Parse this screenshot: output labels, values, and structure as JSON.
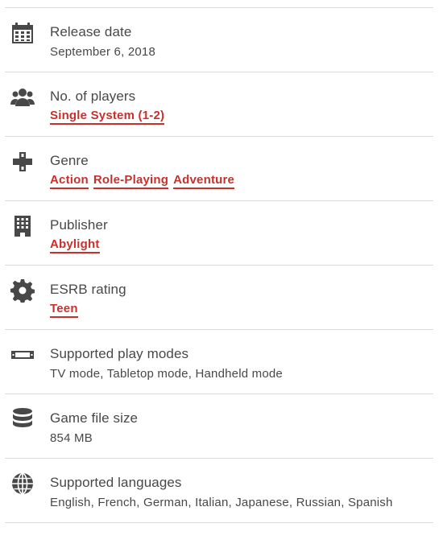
{
  "rows": [
    {
      "title": "Release date",
      "value": "September 6, 2018",
      "icon": "calendar-icon"
    },
    {
      "title": "No. of players",
      "links": [
        "Single System (1-2)"
      ],
      "icon": "players-icon"
    },
    {
      "title": "Genre",
      "links": [
        "Action",
        "Role-Playing",
        "Adventure"
      ],
      "icon": "dpad-icon"
    },
    {
      "title": "Publisher",
      "links": [
        "Abylight"
      ],
      "icon": "building-icon"
    },
    {
      "title": "ESRB rating",
      "links": [
        "Teen"
      ],
      "icon": "gear-icon"
    },
    {
      "title": "Supported play modes",
      "value": "TV mode, Tabletop mode, Handheld mode",
      "icon": "console-icon"
    },
    {
      "title": "Game file size",
      "value": "854 MB",
      "icon": "database-icon"
    },
    {
      "title": "Supported languages",
      "value": "English, French, German, Italian, Japanese, Russian, Spanish",
      "icon": "globe-icon"
    }
  ],
  "colors": {
    "text": "#484848",
    "link": "#c9302c",
    "divider": "#d9d9d9"
  }
}
